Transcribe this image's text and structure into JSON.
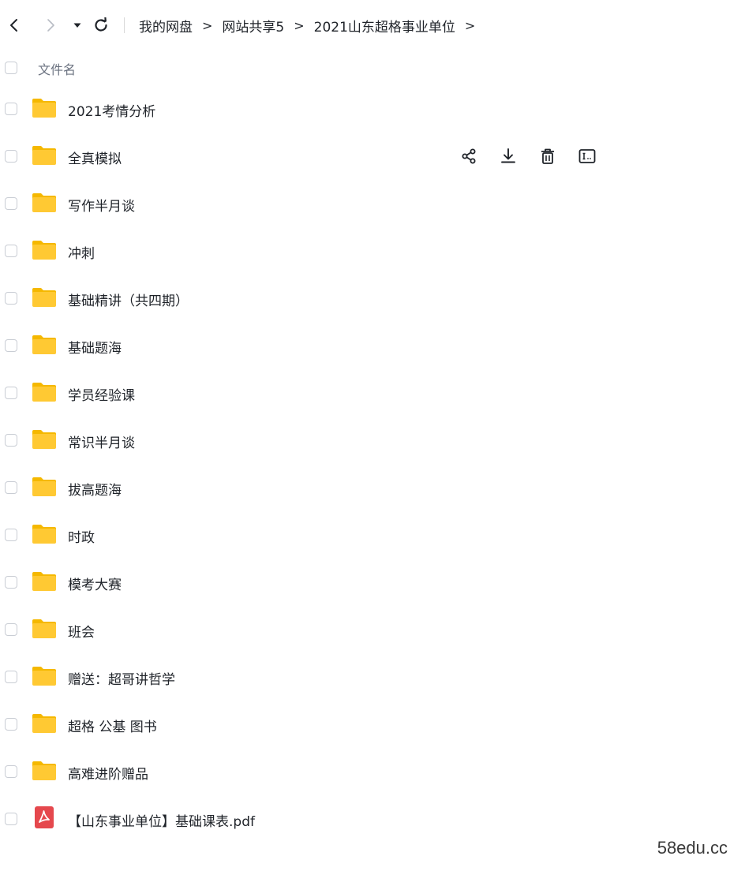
{
  "toolbar": {
    "back_icon": "chevron-left-icon",
    "forward_icon": "chevron-right-icon",
    "history_icon": "caret-down-icon",
    "refresh_icon": "refresh-icon"
  },
  "breadcrumb": {
    "items": [
      "我的网盘",
      "网站共享5",
      "2021山东超格事业单位"
    ],
    "separator": ">"
  },
  "header": {
    "column_label": "文件名"
  },
  "files": [
    {
      "name": "2021考情分析",
      "type": "folder"
    },
    {
      "name": "全真模拟",
      "type": "folder"
    },
    {
      "name": "写作半月谈",
      "type": "folder"
    },
    {
      "name": "冲刺",
      "type": "folder"
    },
    {
      "name": "基础精讲（共四期）",
      "type": "folder"
    },
    {
      "name": "基础题海",
      "type": "folder"
    },
    {
      "name": "学员经验课",
      "type": "folder"
    },
    {
      "name": "常识半月谈",
      "type": "folder"
    },
    {
      "name": "拔高题海",
      "type": "folder"
    },
    {
      "name": "时政",
      "type": "folder"
    },
    {
      "name": "模考大赛",
      "type": "folder"
    },
    {
      "name": "班会",
      "type": "folder"
    },
    {
      "name": "赠送：超哥讲哲学",
      "type": "folder"
    },
    {
      "name": "超格 公基 图书",
      "type": "folder"
    },
    {
      "name": "高难进阶赠品",
      "type": "folder"
    },
    {
      "name": "【山东事业单位】基础课表.pdf",
      "type": "pdf"
    }
  ],
  "row_actions": [
    "share-icon",
    "download-icon",
    "delete-icon",
    "rename-icon"
  ],
  "colors": {
    "folder": "#ffc933",
    "folder_tab": "#f5b800",
    "pdf": "#e5484d",
    "text": "#1f2329"
  },
  "watermark": "58edu.cc"
}
